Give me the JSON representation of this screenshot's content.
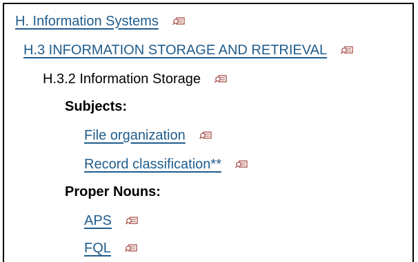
{
  "tree": {
    "level1": {
      "label": "H. Information Systems",
      "icon": "magnifier-icon"
    },
    "level2": {
      "label": "H.3 INFORMATION STORAGE AND RETRIEVAL",
      "icon": "magnifier-icon"
    },
    "level3": {
      "label": "H.3.2 Information Storage",
      "icon": "magnifier-icon"
    },
    "subjects": {
      "heading": "Subjects:",
      "items": [
        {
          "label": "File organization",
          "icon": "magnifier-icon"
        },
        {
          "label": "Record classification**",
          "icon": "magnifier-icon"
        }
      ]
    },
    "proper_nouns": {
      "heading": "Proper Nouns:",
      "items": [
        {
          "label": "APS",
          "icon": "magnifier-icon"
        },
        {
          "label": "FQL",
          "icon": "magnifier-icon"
        }
      ]
    }
  },
  "colors": {
    "link": "#1f5c8c",
    "icon": "#a0403a",
    "border": "#000000"
  }
}
